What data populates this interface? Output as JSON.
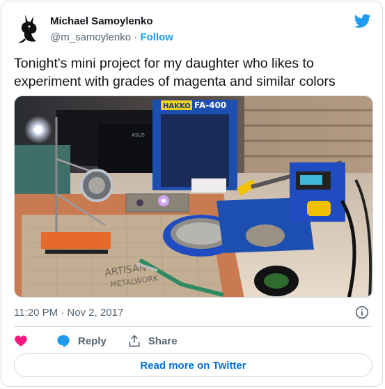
{
  "author": {
    "name": "Michael Samoylenko",
    "handle": "@m_samoylenko",
    "separator": " · ",
    "follow_label": "Follow"
  },
  "tweet": {
    "text": "Tonight's mini project for my daughter who likes to experiment with grades of magenta and similar colors",
    "timestamp": "11:20 PM · Nov 2, 2017"
  },
  "actions": {
    "like_label": "",
    "reply_label": "Reply",
    "share_label": "Share"
  },
  "read_more_label": "Read more on Twitter",
  "photo_text": {
    "hakko_label": "HAKKO",
    "station_label": "FA-400",
    "monitor_brand": "ASUS",
    "mat_brand": "ARTISAN",
    "mat_sub": "METALWORK"
  },
  "icons": {
    "logo": "twitter-bird-icon",
    "info": "info-icon",
    "like": "heart-icon",
    "reply": "reply-bubble-icon",
    "share": "share-icon"
  },
  "colors": {
    "accent": "#1d9bf0",
    "like": "#f91880",
    "text_primary": "#0f1419",
    "text_secondary": "#536471",
    "border": "#cfd9de",
    "read_more": "#006fd6"
  }
}
